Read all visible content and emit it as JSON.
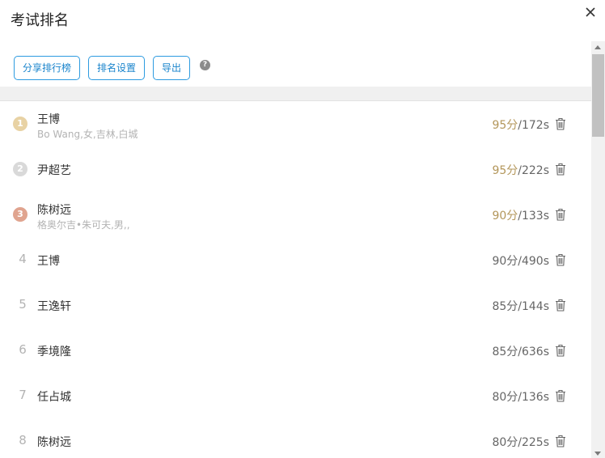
{
  "dialog": {
    "title": "考试排名"
  },
  "toolbar": {
    "share_label": "分享排行榜",
    "settings_label": "排名设置",
    "export_label": "导出",
    "help_glyph": "?"
  },
  "colors": {
    "accent": "#2d9be0",
    "gold": "#e8d2a4",
    "silver": "#d9d9d9",
    "bronze": "#e0a48f",
    "top_score": "#b3965a"
  },
  "rankings": [
    {
      "rank": "1",
      "name": "王博",
      "sub": "Bo Wang,女,吉林,白城",
      "score": "95分",
      "time": "/172s"
    },
    {
      "rank": "2",
      "name": "尹超艺",
      "sub": "",
      "score": "95分",
      "time": "/222s"
    },
    {
      "rank": "3",
      "name": "陈树远",
      "sub": "格奥尔吉•朱可夫,男,,",
      "score": "90分",
      "time": "/133s"
    },
    {
      "rank": "4",
      "name": "王博",
      "sub": "",
      "score": "90分",
      "time": "/490s"
    },
    {
      "rank": "5",
      "name": "王逸轩",
      "sub": "",
      "score": "85分",
      "time": "/144s"
    },
    {
      "rank": "6",
      "name": "季境隆",
      "sub": "",
      "score": "85分",
      "time": "/636s"
    },
    {
      "rank": "7",
      "name": "任占城",
      "sub": "",
      "score": "80分",
      "time": "/136s"
    },
    {
      "rank": "8",
      "name": "陈树远",
      "sub": "",
      "score": "80分",
      "time": "/225s"
    }
  ]
}
